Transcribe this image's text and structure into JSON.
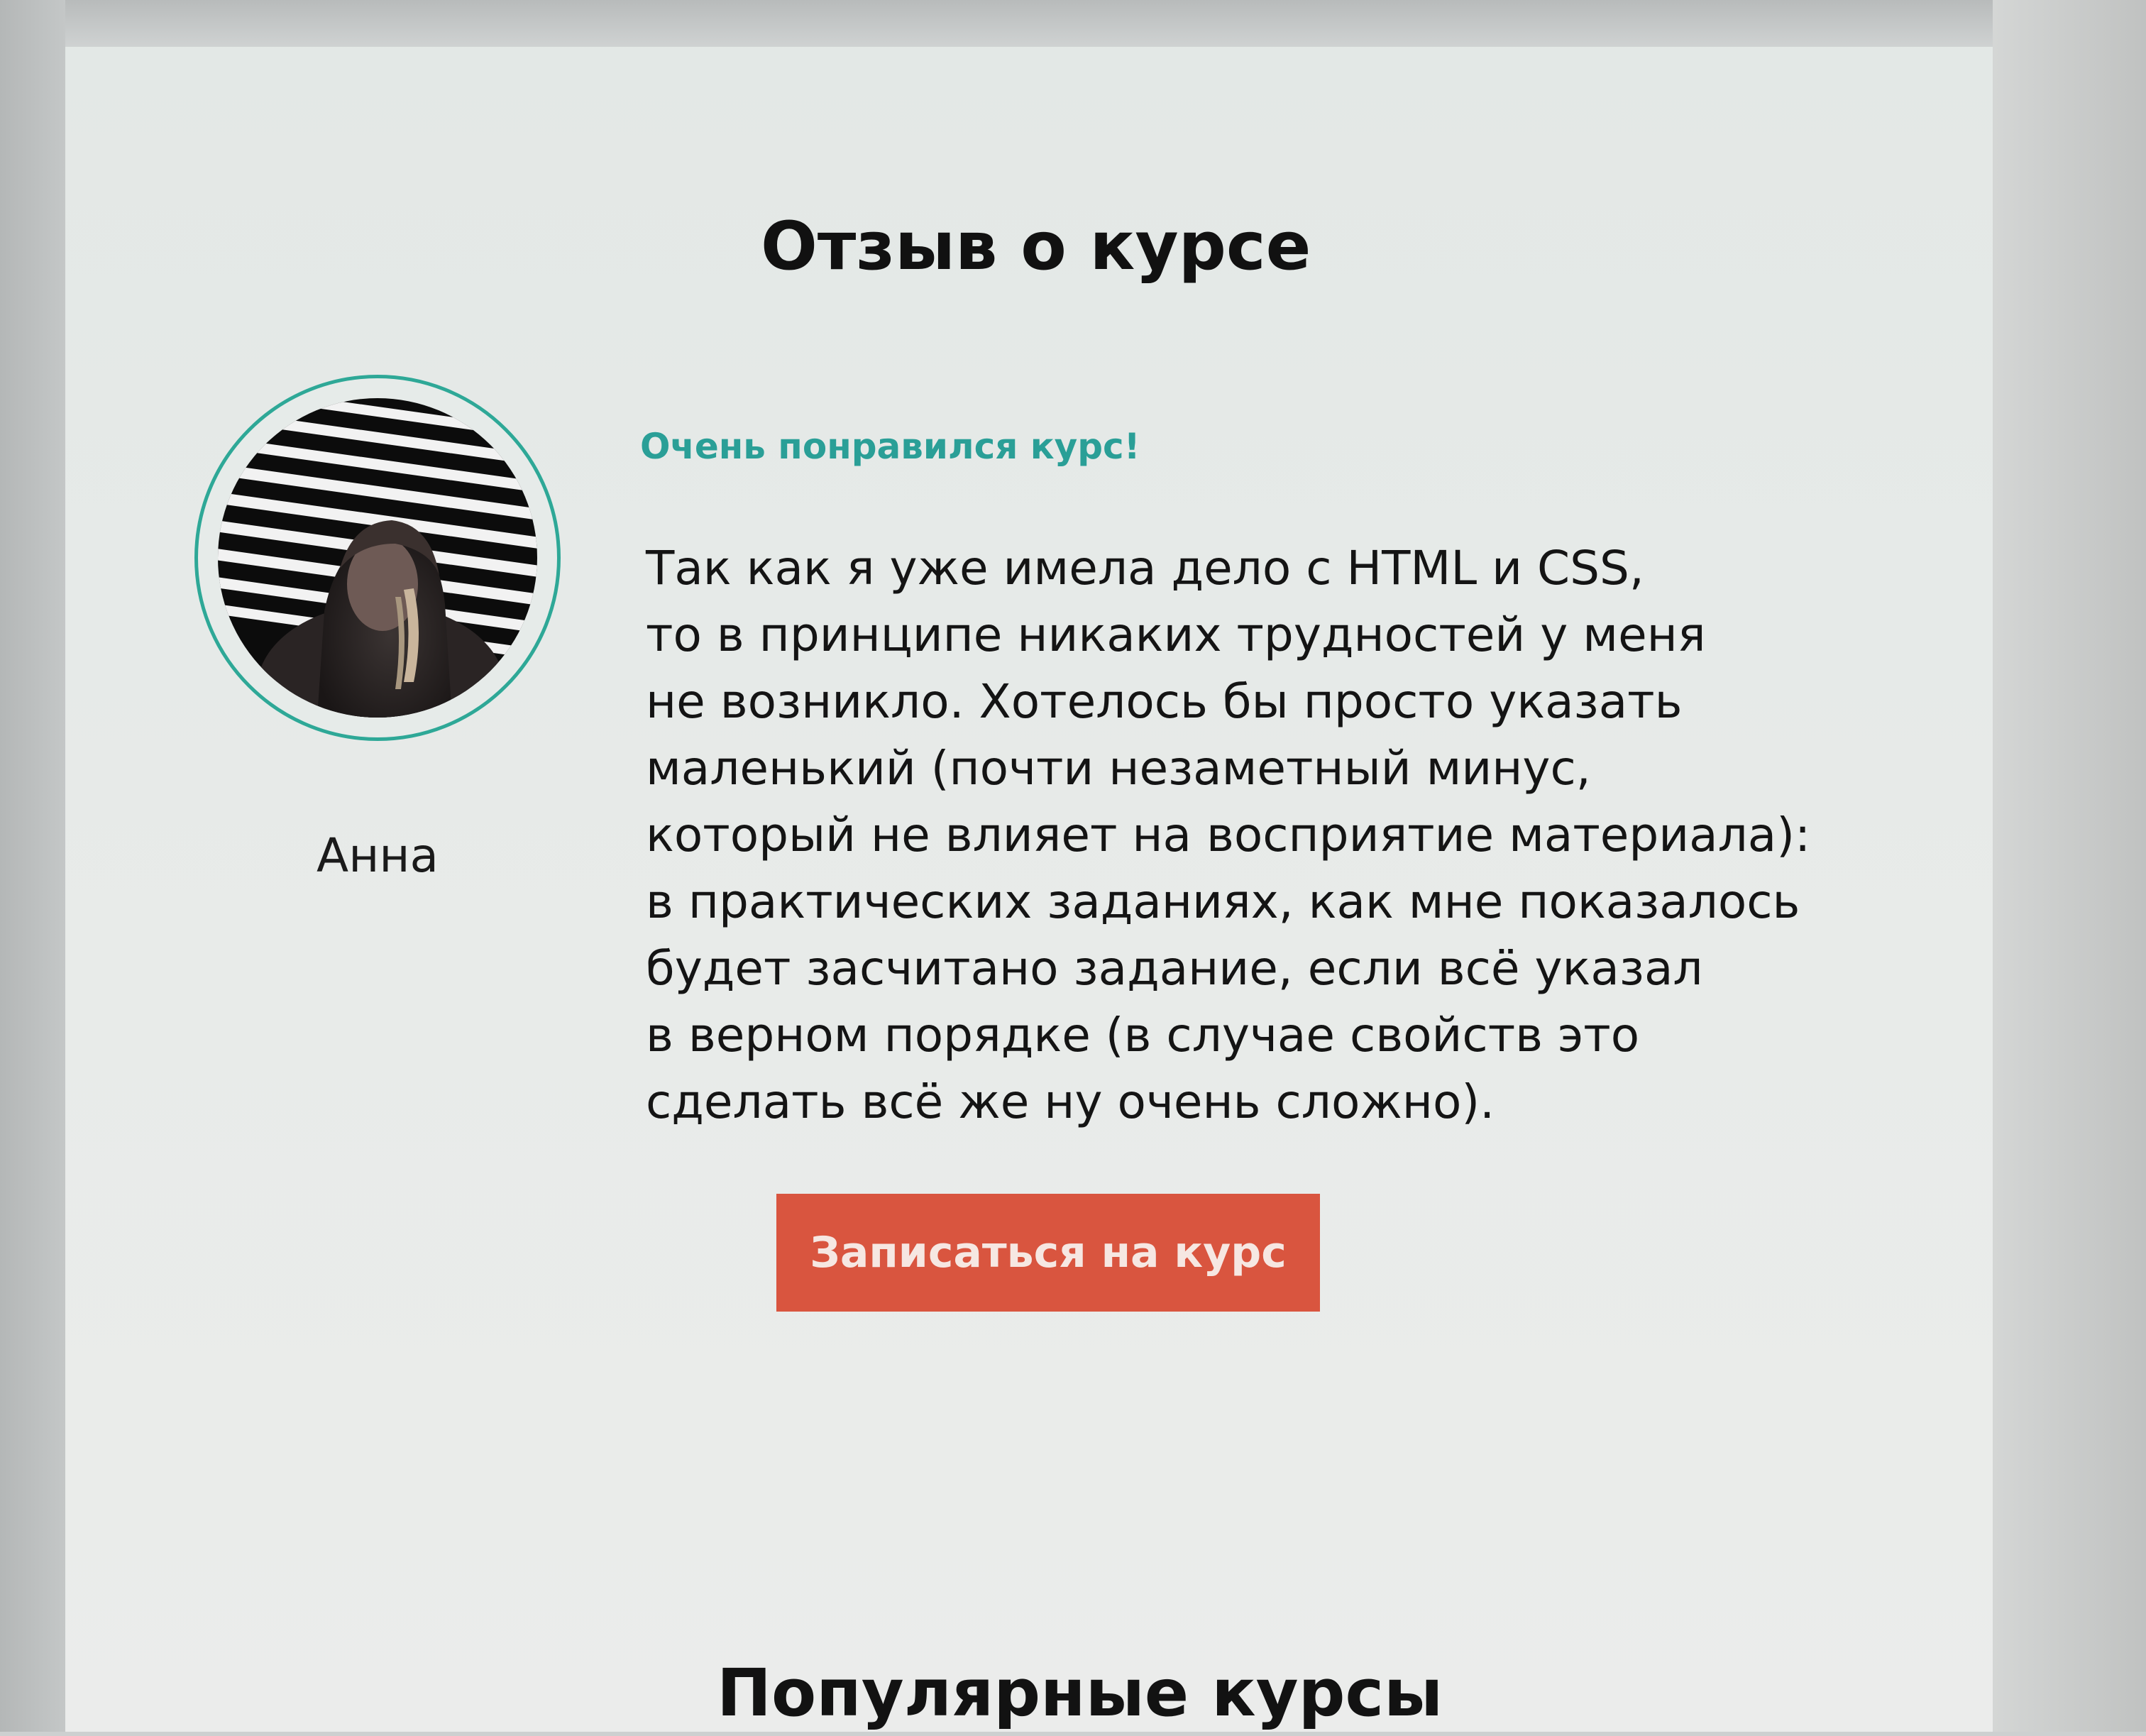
{
  "review_section": {
    "title": "Отзыв о курсе",
    "author": {
      "name": "Анна",
      "avatar": "photo-avatar"
    },
    "review_title": "Очень понравился курс!",
    "review_lines": [
      "Так как я уже имела дело с HTML и CSS,",
      "то в принципе никаких трудностей у меня",
      "не возникло. Хотелось бы просто указать",
      "маленький (почти незаметный минус,",
      "который не влияет на восприятие материала):",
      "в практических заданиях, как мне показалось",
      "будет засчитано задание, если всё указал",
      "в верном порядке (в случае свойств это",
      "сделать всё же ну очень сложно)."
    ],
    "enroll_button_label": "Записаться на курс"
  },
  "popular_section": {
    "title": "Популярные курсы"
  },
  "colors": {
    "accent_teal": "#2a9f97",
    "button_red": "#d9553f",
    "text_dark": "#141414",
    "page_background": "#e6eae8"
  }
}
